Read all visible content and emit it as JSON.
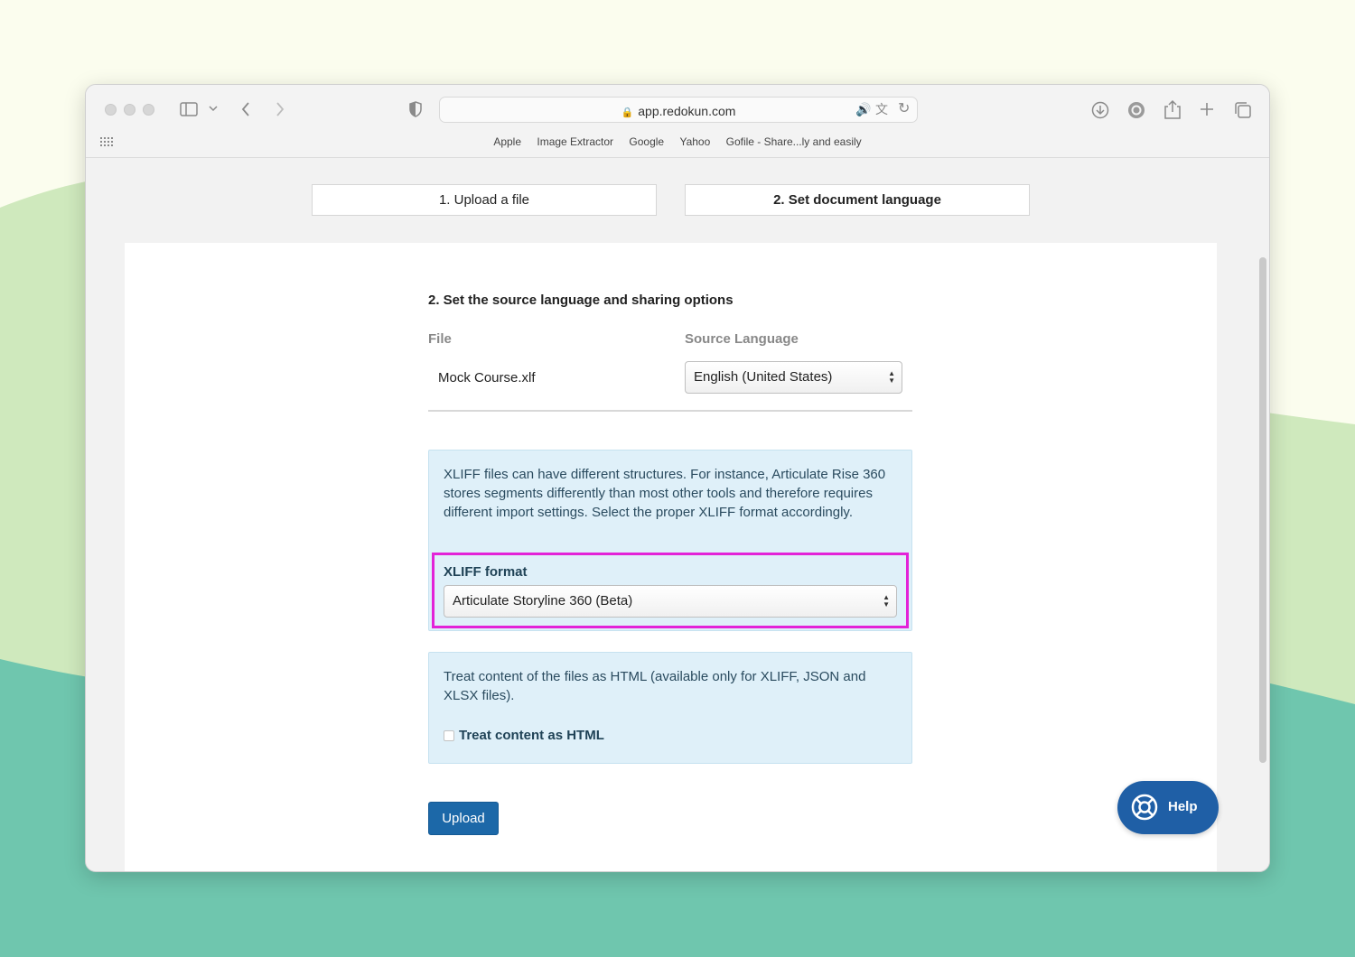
{
  "browser": {
    "url": "app.redokun.com",
    "bookmarks": [
      "Apple",
      "Image Extractor",
      "Google",
      "Yahoo",
      "Gofile - Share...ly and easily"
    ]
  },
  "steps": [
    {
      "label": "1. Upload a file",
      "active": false
    },
    {
      "label": "2. Set document language",
      "active": true
    }
  ],
  "form": {
    "title": "2. Set the source language and sharing options",
    "file_label": "File",
    "source_label": "Source Language",
    "file_name": "Mock Course.xlf",
    "source_language": "English (United States)",
    "xliff_info": "XLIFF files can have different structures. For instance, Articulate Rise 360 stores segments differently than most other tools and therefore requires different import settings. Select the proper XLIFF format accordingly.",
    "xliff_label": "XLIFF format",
    "xliff_value": "Articulate Storyline 360 (Beta)",
    "html_info": "Treat content of the files as HTML (available only for XLIFF, JSON and XLSX files).",
    "html_checkbox_label": "Treat content as HTML",
    "upload_label": "Upload"
  },
  "help": {
    "label": "Help"
  },
  "colors": {
    "accent": "#1c68a8",
    "highlight": "#e323d8",
    "info_bg": "#dff0f9",
    "help_bg": "#1f5fa6"
  }
}
